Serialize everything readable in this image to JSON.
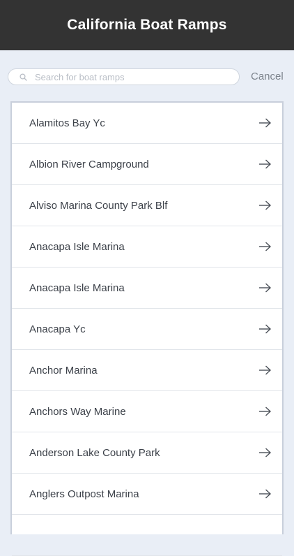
{
  "header": {
    "title": "California Boat Ramps"
  },
  "search": {
    "placeholder": "Search for boat ramps",
    "value": "",
    "cancel_label": "Cancel"
  },
  "list": {
    "items": [
      {
        "label": "Alamitos Bay Yc"
      },
      {
        "label": "Albion River Campground"
      },
      {
        "label": "Alviso Marina County Park Blf"
      },
      {
        "label": "Anacapa Isle Marina"
      },
      {
        "label": "Anacapa Isle Marina"
      },
      {
        "label": "Anacapa Yc"
      },
      {
        "label": "Anchor Marina"
      },
      {
        "label": "Anchors Way Marine"
      },
      {
        "label": "Anderson Lake County Park"
      },
      {
        "label": "Anglers Outpost Marina"
      },
      {
        "label": ""
      }
    ]
  },
  "icons": {
    "search": "search-icon",
    "row_action": "arrow-right-icon"
  },
  "colors": {
    "header_bg": "#333333",
    "page_bg": "#e9eef6",
    "text": "#3c4149",
    "cancel": "#7d848d"
  }
}
